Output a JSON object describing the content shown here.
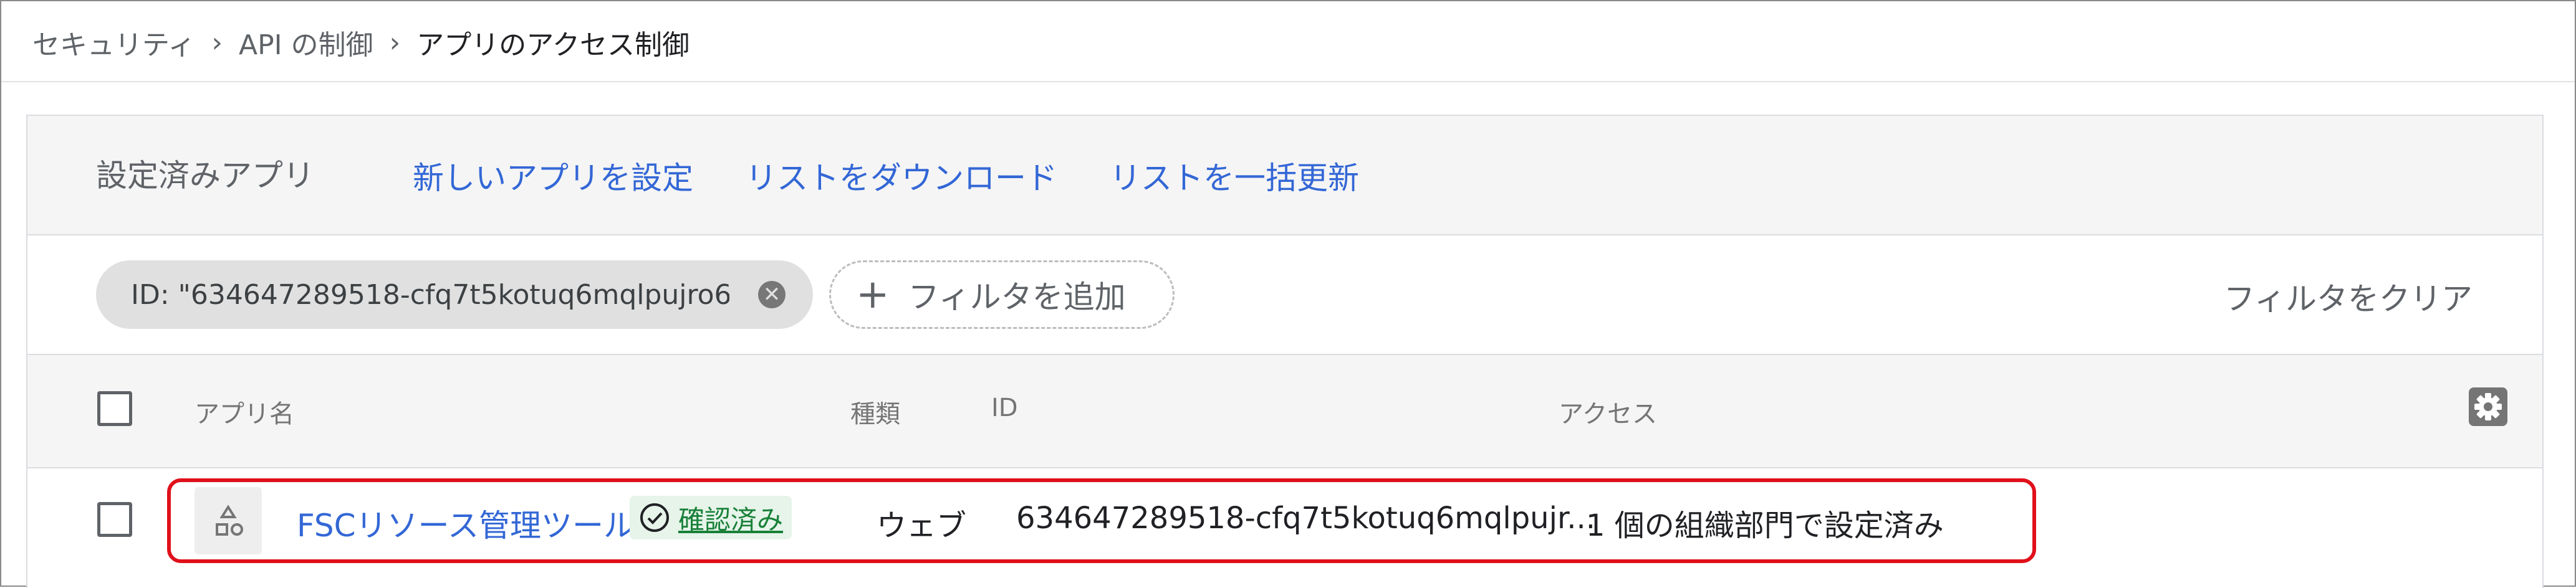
{
  "breadcrumb": {
    "items": [
      "セキュリティ",
      "API の制御"
    ],
    "current": "アプリのアクセス制御",
    "separator": "›"
  },
  "toolbar": {
    "title": "設定済みアプリ",
    "actions": [
      "新しいアプリを設定",
      "リストをダウンロード",
      "リストを一括更新"
    ]
  },
  "filters": {
    "chip_text": "ID: \"634647289518-cfq7t5kotuq6mqlpujro6...",
    "add_label": "フィルタを追加",
    "clear_label": "フィルタをクリア"
  },
  "table": {
    "columns": [
      "アプリ名",
      "種類",
      "ID",
      "アクセス"
    ],
    "rows": [
      {
        "name": "FSCリソース管理ツール",
        "badge": "確認済み",
        "type": "ウェブ",
        "id": "634647289518-cfq7t5kotuq6mqlpujr...",
        "access": "1 個の組織部門で設定済み"
      }
    ]
  },
  "colors": {
    "link": "#3367d6",
    "verified": "#188038",
    "highlight": "#e0101a",
    "toolbar_bg": "#f5f5f5"
  },
  "icons": [
    "chevron-right-icon",
    "close-circle-icon",
    "plus-icon",
    "gear-icon",
    "shapes-icon",
    "check-circle-icon"
  ]
}
